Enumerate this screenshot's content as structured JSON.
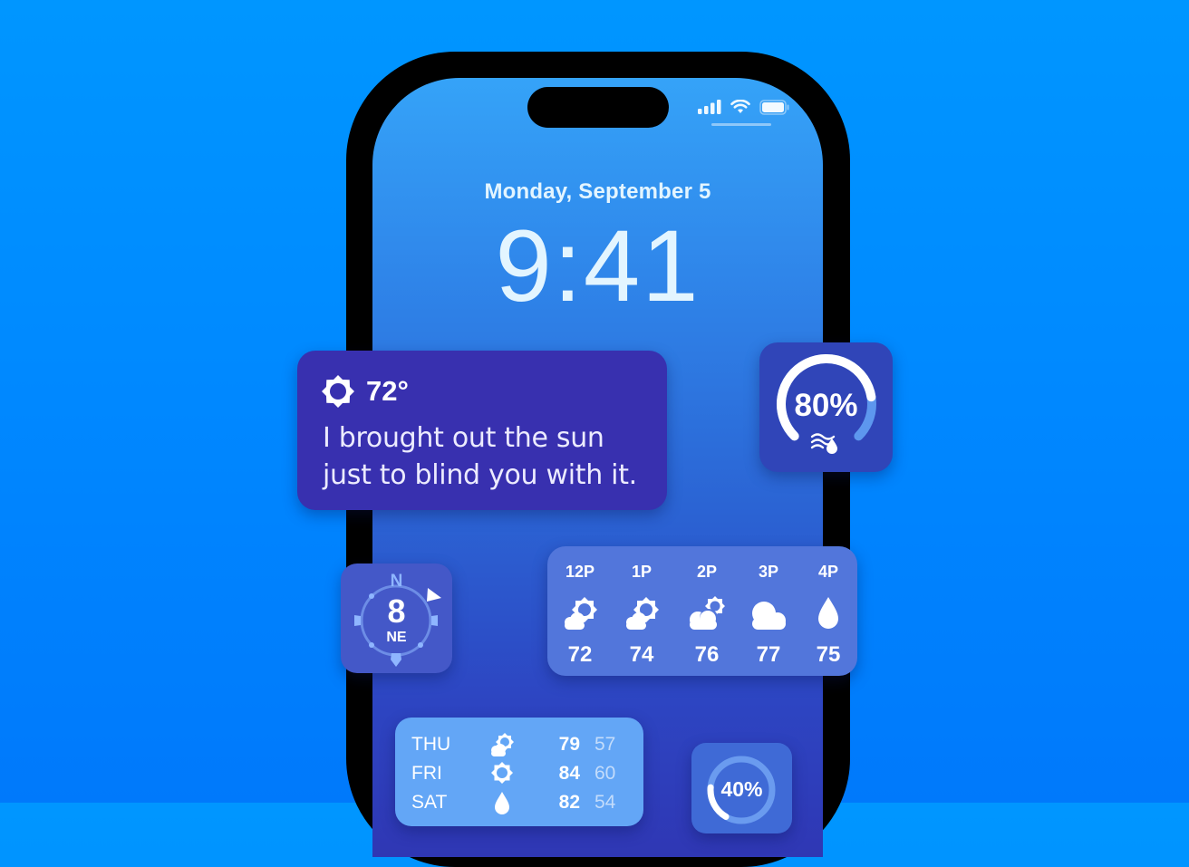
{
  "lock_screen": {
    "date": "Monday, September 5",
    "time": "9:41",
    "status_bar": {
      "signal_icon": "cellular-signal-icon",
      "wifi_icon": "wifi-icon",
      "battery_icon": "battery-icon"
    }
  },
  "widgets": {
    "quote": {
      "icon": "sun-icon",
      "temperature": "72°",
      "line1": "I brought out the sun",
      "line2": "just to blind you with it."
    },
    "humidity": {
      "value_label": "80%",
      "value": 0.8,
      "icon": "humidity-icon"
    },
    "wind": {
      "north_label": "N",
      "speed": "8",
      "direction": "NE",
      "icon": "compass-icon"
    },
    "hourly": [
      {
        "hour": "12P",
        "icon": "partly-sunny-icon",
        "temp": "72"
      },
      {
        "hour": "1P",
        "icon": "partly-sunny-icon",
        "temp": "74"
      },
      {
        "hour": "2P",
        "icon": "mostly-cloudy-icon",
        "temp": "76"
      },
      {
        "hour": "3P",
        "icon": "cloud-icon",
        "temp": "77"
      },
      {
        "hour": "4P",
        "icon": "rain-drop-icon",
        "temp": "75"
      }
    ],
    "daily": [
      {
        "day": "THU",
        "icon": "partly-sunny-icon",
        "high": "79",
        "low": "57"
      },
      {
        "day": "FRI",
        "icon": "sun-icon",
        "high": "84",
        "low": "60"
      },
      {
        "day": "SAT",
        "icon": "rain-drop-icon",
        "high": "82",
        "low": "54"
      }
    ],
    "rain_chance": {
      "value_label": "40%",
      "value": 0.4
    }
  },
  "colors": {
    "background": "#0090ff",
    "quote_widget": "#3830af",
    "humidity_widget": "#3045b8",
    "wind_widget": "#4458c8",
    "hourly_widget": "#5276db",
    "daily_widget": "#63a6f6",
    "rain_widget": "#3f6ad6"
  }
}
